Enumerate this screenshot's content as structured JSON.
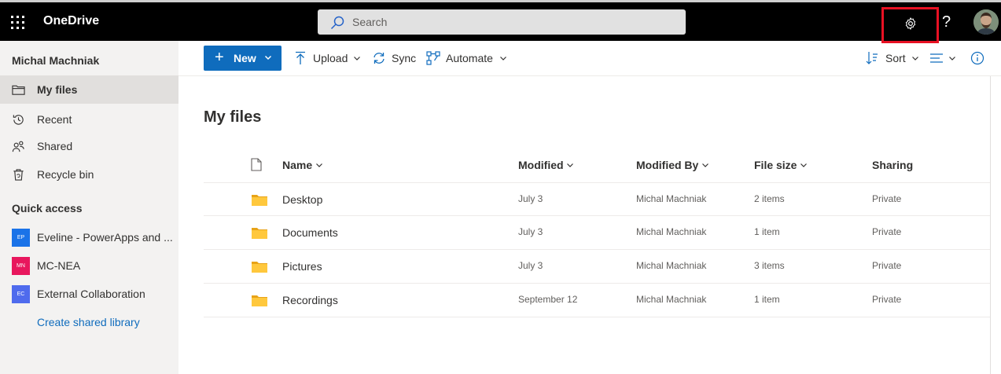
{
  "topbar": {
    "app_name": "OneDrive",
    "search_placeholder": "Search",
    "help_label": "?"
  },
  "sidebar": {
    "user_name": "Michal Machniak",
    "nav": [
      {
        "label": "My files",
        "icon": "folder-icon",
        "active": true
      },
      {
        "label": "Recent",
        "icon": "history-icon"
      },
      {
        "label": "Shared",
        "icon": "shared-people-icon"
      },
      {
        "label": "Recycle bin",
        "icon": "recycle-bin-icon"
      }
    ],
    "quick_access_title": "Quick access",
    "quick_access": [
      {
        "label": "Eveline - PowerApps and ...",
        "badge": "EP",
        "color": "#1a73e8"
      },
      {
        "label": "MC-NEA",
        "badge": "MN",
        "color": "#e8175d"
      },
      {
        "label": "External Collaboration",
        "badge": "EC",
        "color": "#4f6bed"
      }
    ],
    "create_library": "Create shared library"
  },
  "toolbar": {
    "new_label": "New",
    "upload_label": "Upload",
    "sync_label": "Sync",
    "automate_label": "Automate",
    "sort_label": "Sort"
  },
  "main": {
    "title": "My files",
    "columns": {
      "name": "Name",
      "modified": "Modified",
      "modified_by": "Modified By",
      "file_size": "File size",
      "sharing": "Sharing"
    },
    "rows": [
      {
        "name": "Desktop",
        "modified": "July 3",
        "modified_by": "Michal Machniak",
        "size": "2 items",
        "sharing": "Private"
      },
      {
        "name": "Documents",
        "modified": "July 3",
        "modified_by": "Michal Machniak",
        "size": "1 item",
        "sharing": "Private"
      },
      {
        "name": "Pictures",
        "modified": "July 3",
        "modified_by": "Michal Machniak",
        "size": "3 items",
        "sharing": "Private"
      },
      {
        "name": "Recordings",
        "modified": "September 12",
        "modified_by": "Michal Machniak",
        "size": "1 item",
        "sharing": "Private"
      }
    ]
  },
  "colors": {
    "accent": "#0f6cbd",
    "highlight_box": "#e81123",
    "folder": "#ffc83d"
  }
}
